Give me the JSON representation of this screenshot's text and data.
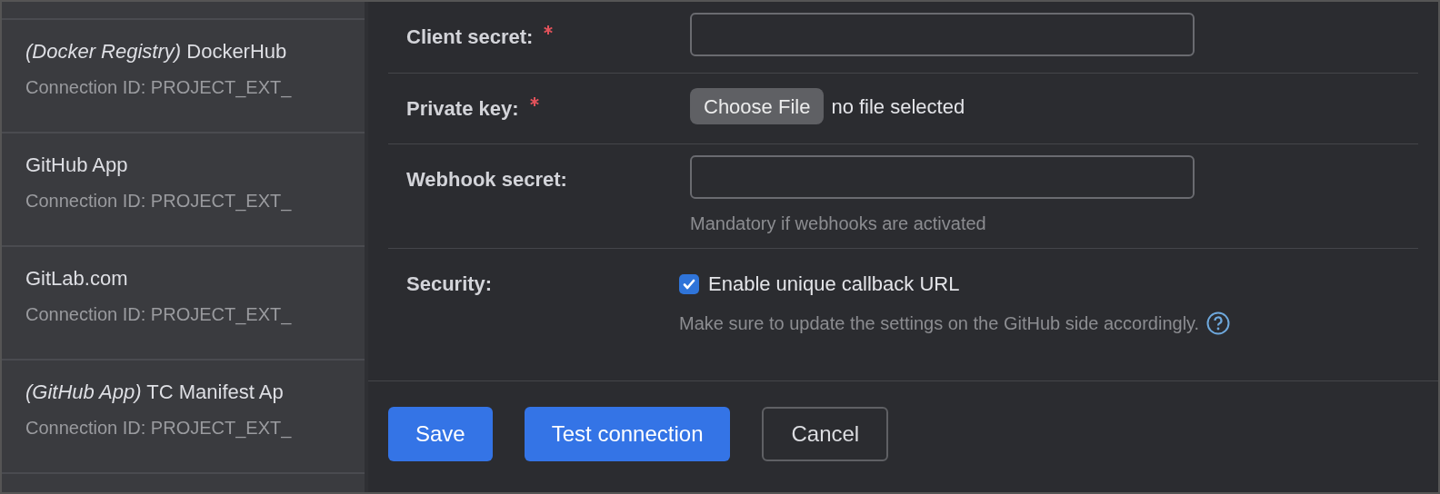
{
  "connections": [
    {
      "title": "*(Docker Registry)* DockerHub",
      "subtitle": "Connection ID: PROJECT_EXT_"
    },
    {
      "title": "GitHub App",
      "subtitle": "Connection ID: PROJECT_EXT_"
    },
    {
      "title": "GitLab.com",
      "subtitle": "Connection ID: PROJECT_EXT_"
    },
    {
      "title": "*(GitHub App)* TC Manifest Ap",
      "subtitle": "Connection ID: PROJECT_EXT_"
    }
  ],
  "form": [
    {
      "kind": "text",
      "label": "Client secret:",
      "required": true
    },
    {
      "kind": "file",
      "label": "Private key:",
      "required": true,
      "button": "Choose File",
      "status": "no file selected"
    },
    {
      "kind": "text",
      "label": "Webhook secret:",
      "required": false,
      "hint": "Mandatory if webhooks are activated"
    },
    {
      "kind": "checkbox",
      "label": "Security:",
      "required": false,
      "checked": true,
      "option": "Enable unique callback URL",
      "hint": "Make sure to update the settings on the GitHub side accordingly."
    }
  ],
  "buttons": [
    {
      "label": "Save",
      "primary": true
    },
    {
      "label": "Test connection",
      "primary": true
    },
    {
      "label": "Cancel",
      "primary": false
    }
  ]
}
